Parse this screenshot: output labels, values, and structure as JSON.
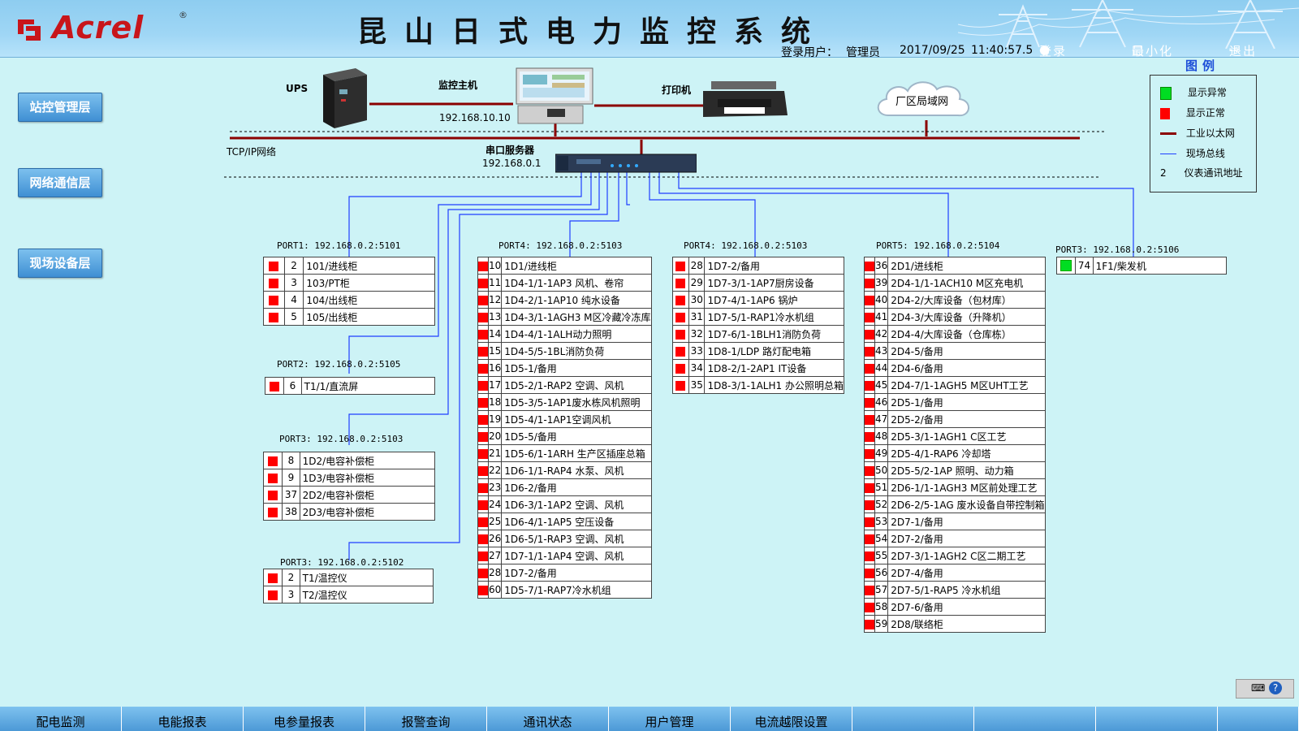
{
  "header": {
    "logo_text": "Acrel",
    "logo_reg": "®",
    "title": "昆山日式电力监控系统",
    "login_user_label": "登录用户：",
    "user_name": "管理员",
    "date": "2017/09/25",
    "time": "11:40:57.5",
    "login_btn": "登录",
    "minimize_btn": "最小化",
    "exit_btn": "退出"
  },
  "side_buttons": [
    "站控管理层",
    "网络通信层",
    "现场设备层"
  ],
  "network": {
    "ups": "UPS",
    "host": "监控主机",
    "host_ip": "192.168.10.10",
    "printer": "打印机",
    "lan": "厂区局域网",
    "tcpip": "TCP/IP网络",
    "serial_server": "串口服务器",
    "serial_ip": "192.168.0.1"
  },
  "legend": {
    "title": "图例",
    "items": [
      {
        "label": "显示异常",
        "color": "#00dd22"
      },
      {
        "label": "显示正常",
        "color": "#ff0000"
      },
      {
        "label": "工业以太网",
        "color": "#8b0000"
      },
      {
        "label": "现场总线",
        "color": "#1f3fff"
      },
      {
        "symbol": "2",
        "label": "仪表通讯地址"
      }
    ]
  },
  "groups": [
    {
      "port": "PORT1: 192.168.0.2:5101",
      "rows": [
        {
          "no": "2",
          "name": "101/进线柜",
          "status": "red"
        },
        {
          "no": "3",
          "name": "103/PT柜",
          "status": "red"
        },
        {
          "no": "4",
          "name": "104/出线柜",
          "status": "red"
        },
        {
          "no": "5",
          "name": "105/出线柜",
          "status": "red"
        }
      ]
    },
    {
      "port": "PORT2: 192.168.0.2:5105",
      "rows": [
        {
          "no": "6",
          "name": "T1/1/直流屏",
          "status": "red"
        }
      ]
    },
    {
      "port": "PORT3: 192.168.0.2:5103",
      "rows": [
        {
          "no": "8",
          "name": "1D2/电容补偿柜",
          "status": "red"
        },
        {
          "no": "9",
          "name": "1D3/电容补偿柜",
          "status": "red"
        },
        {
          "no": "37",
          "name": "2D2/电容补偿柜",
          "status": "red"
        },
        {
          "no": "38",
          "name": "2D3/电容补偿柜",
          "status": "red"
        }
      ]
    },
    {
      "port": "PORT3: 192.168.0.2:5102",
      "rows": [
        {
          "no": "2",
          "name": "T1/温控仪",
          "status": "red"
        },
        {
          "no": "3",
          "name": "T2/温控仪",
          "status": "red"
        }
      ]
    },
    {
      "port": "PORT4: 192.168.0.2:5103",
      "rows": [
        {
          "no": "10",
          "name": "1D1/进线柜",
          "status": "red"
        },
        {
          "no": "11",
          "name": "1D4-1/1-1AP3 风机、卷帘",
          "status": "red"
        },
        {
          "no": "12",
          "name": "1D4-2/1-1AP10 纯水设备",
          "status": "red"
        },
        {
          "no": "13",
          "name": "1D4-3/1-1AGH3 M区冷藏冷冻库",
          "status": "red"
        },
        {
          "no": "14",
          "name": "1D4-4/1-1ALH动力照明",
          "status": "red"
        },
        {
          "no": "15",
          "name": "1D4-5/5-1BL消防负荷",
          "status": "red"
        },
        {
          "no": "16",
          "name": "1D5-1/备用",
          "status": "red"
        },
        {
          "no": "17",
          "name": "1D5-2/1-RAP2 空调、风机",
          "status": "red"
        },
        {
          "no": "18",
          "name": "1D5-3/5-1AP1废水栋风机照明",
          "status": "red"
        },
        {
          "no": "19",
          "name": "1D5-4/1-1AP1空调风机",
          "status": "red"
        },
        {
          "no": "20",
          "name": "1D5-5/备用",
          "status": "red"
        },
        {
          "no": "21",
          "name": "1D5-6/1-1ARH 生产区插座总箱",
          "status": "red"
        },
        {
          "no": "22",
          "name": "1D6-1/1-RAP4 水泵、风机",
          "status": "red"
        },
        {
          "no": "23",
          "name": "1D6-2/备用",
          "status": "red"
        },
        {
          "no": "24",
          "name": "1D6-3/1-1AP2 空调、风机",
          "status": "red"
        },
        {
          "no": "25",
          "name": "1D6-4/1-1AP5 空压设备",
          "status": "red"
        },
        {
          "no": "26",
          "name": "1D6-5/1-RAP3 空调、风机",
          "status": "red"
        },
        {
          "no": "27",
          "name": "1D7-1/1-1AP4 空调、风机",
          "status": "red"
        },
        {
          "no": "28",
          "name": "1D7-2/备用",
          "status": "red"
        },
        {
          "no": "60",
          "name": "1D5-7/1-RAP7冷水机组",
          "status": "red"
        }
      ]
    },
    {
      "port": "PORT4: 192.168.0.2:5103",
      "rows": [
        {
          "no": "28",
          "name": "1D7-2/备用",
          "status": "red"
        },
        {
          "no": "29",
          "name": "1D7-3/1-1AP7厨房设备",
          "status": "red"
        },
        {
          "no": "30",
          "name": "1D7-4/1-1AP6 锅炉",
          "status": "red"
        },
        {
          "no": "31",
          "name": "1D7-5/1-RAP1冷水机组",
          "status": "red"
        },
        {
          "no": "32",
          "name": "1D7-6/1-1BLH1消防负荷",
          "status": "red"
        },
        {
          "no": "33",
          "name": "1D8-1/LDP 路灯配电箱",
          "status": "red"
        },
        {
          "no": "34",
          "name": "1D8-2/1-2AP1 IT设备",
          "status": "red"
        },
        {
          "no": "35",
          "name": "1D8-3/1-1ALH1 办公照明总箱",
          "status": "red"
        }
      ]
    },
    {
      "port": "PORT5: 192.168.0.2:5104",
      "rows": [
        {
          "no": "36",
          "name": "2D1/进线柜",
          "status": "red"
        },
        {
          "no": "39",
          "name": "2D4-1/1-1ACH10 M区充电机",
          "status": "red"
        },
        {
          "no": "40",
          "name": "2D4-2/大库设备（包材库）",
          "status": "red"
        },
        {
          "no": "41",
          "name": "2D4-3/大库设备（升降机）",
          "status": "red"
        },
        {
          "no": "42",
          "name": "2D4-4/大库设备（仓库栋）",
          "status": "red"
        },
        {
          "no": "43",
          "name": "2D4-5/备用",
          "status": "red"
        },
        {
          "no": "44",
          "name": "2D4-6/备用",
          "status": "red"
        },
        {
          "no": "45",
          "name": "2D4-7/1-1AGH5 M区UHT工艺",
          "status": "red"
        },
        {
          "no": "46",
          "name": "2D5-1/备用",
          "status": "red"
        },
        {
          "no": "47",
          "name": "2D5-2/备用",
          "status": "red"
        },
        {
          "no": "48",
          "name": "2D5-3/1-1AGH1 C区工艺",
          "status": "red"
        },
        {
          "no": "49",
          "name": "2D5-4/1-RAP6 冷却塔",
          "status": "red"
        },
        {
          "no": "50",
          "name": "2D5-5/2-1AP 照明、动力箱",
          "status": "red"
        },
        {
          "no": "51",
          "name": "2D6-1/1-1AGH3 M区前处理工艺",
          "status": "red"
        },
        {
          "no": "52",
          "name": "2D6-2/5-1AG 废水设备自带控制箱",
          "status": "red"
        },
        {
          "no": "53",
          "name": "2D7-1/备用",
          "status": "red"
        },
        {
          "no": "54",
          "name": "2D7-2/备用",
          "status": "red"
        },
        {
          "no": "55",
          "name": "2D7-3/1-1AGH2 C区二期工艺",
          "status": "red"
        },
        {
          "no": "56",
          "name": "2D7-4/备用",
          "status": "red"
        },
        {
          "no": "57",
          "name": "2D7-5/1-RAP5 冷水机组",
          "status": "red"
        },
        {
          "no": "58",
          "name": "2D7-6/备用",
          "status": "red"
        },
        {
          "no": "59",
          "name": "2D8/联络柜",
          "status": "red"
        }
      ]
    },
    {
      "port": "PORT3: 192.168.0.2:5106",
      "rows": [
        {
          "no": "74",
          "name": "1F1/柴发机",
          "status": "green"
        }
      ]
    }
  ],
  "footer_tabs": [
    "配电监测",
    "电能报表",
    "电参量报表",
    "报警查询",
    "通讯状态",
    "用户管理",
    "电流越限设置",
    "",
    "",
    "",
    ""
  ]
}
